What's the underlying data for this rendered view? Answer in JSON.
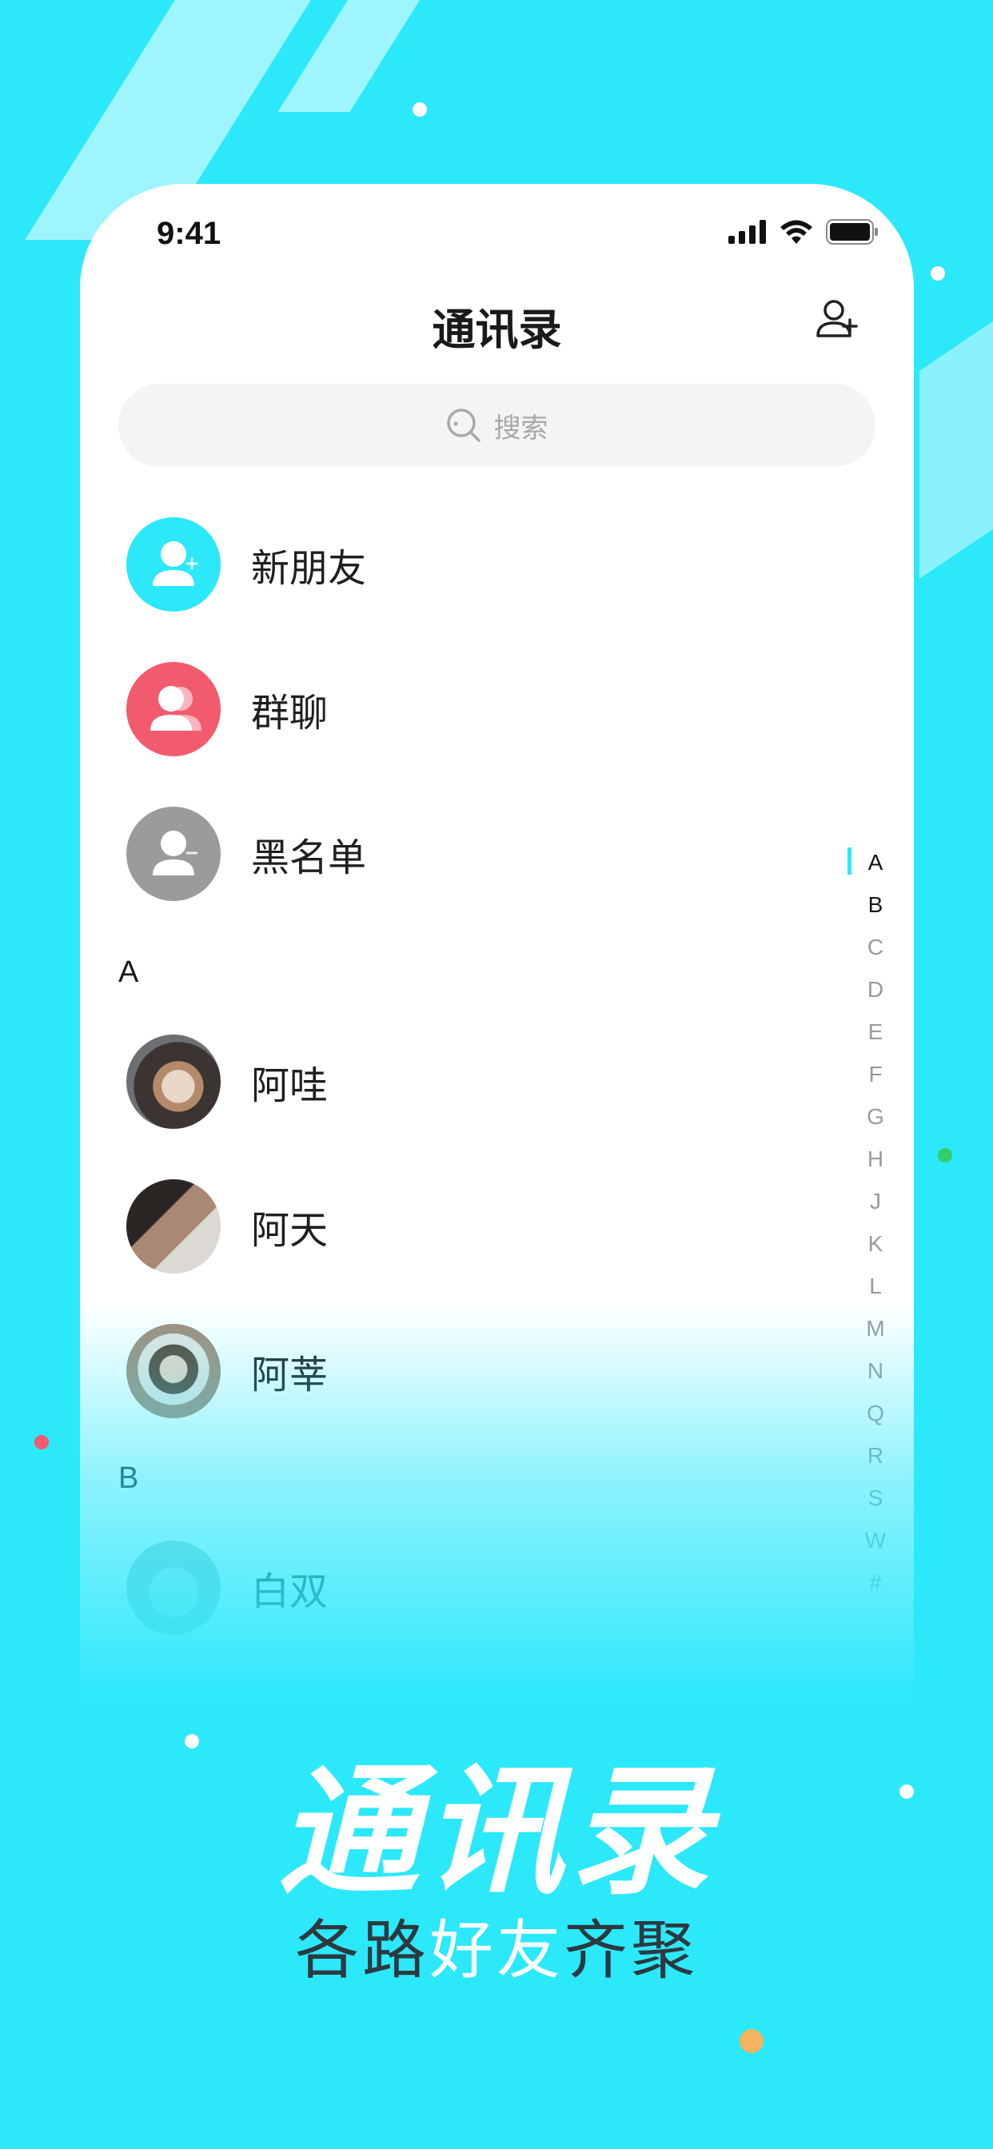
{
  "status_bar": {
    "time": "9:41"
  },
  "header": {
    "title": "通讯录"
  },
  "search": {
    "placeholder": "搜索"
  },
  "fixed_items": [
    {
      "label": "新朋友",
      "icon": "new-friend-icon",
      "color": "#2ce8fb"
    },
    {
      "label": "群聊",
      "icon": "group-chat-icon",
      "color": "#f25b6e"
    },
    {
      "label": "黑名单",
      "icon": "blacklist-icon",
      "color": "#9b9b9b"
    }
  ],
  "sections": [
    {
      "letter": "A",
      "contacts": [
        {
          "name": "阿哇"
        },
        {
          "name": "阿天"
        },
        {
          "name": "阿莘"
        }
      ]
    },
    {
      "letter": "B",
      "contacts": [
        {
          "name": "白双"
        }
      ]
    }
  ],
  "index_bar": [
    "A",
    "B",
    "C",
    "D",
    "E",
    "F",
    "G",
    "H",
    "J",
    "K",
    "L",
    "M",
    "N",
    "Q",
    "R",
    "S",
    "W",
    "#"
  ],
  "index_active": "A",
  "promo": {
    "title": "通讯录",
    "subtitle_part1": "各路",
    "subtitle_highlight": "好友",
    "subtitle_part2": "齐聚"
  },
  "colors": {
    "background": "#2ce8fb",
    "accent": "#2ce8fb",
    "group": "#f25b6e",
    "blacklist": "#9b9b9b"
  }
}
